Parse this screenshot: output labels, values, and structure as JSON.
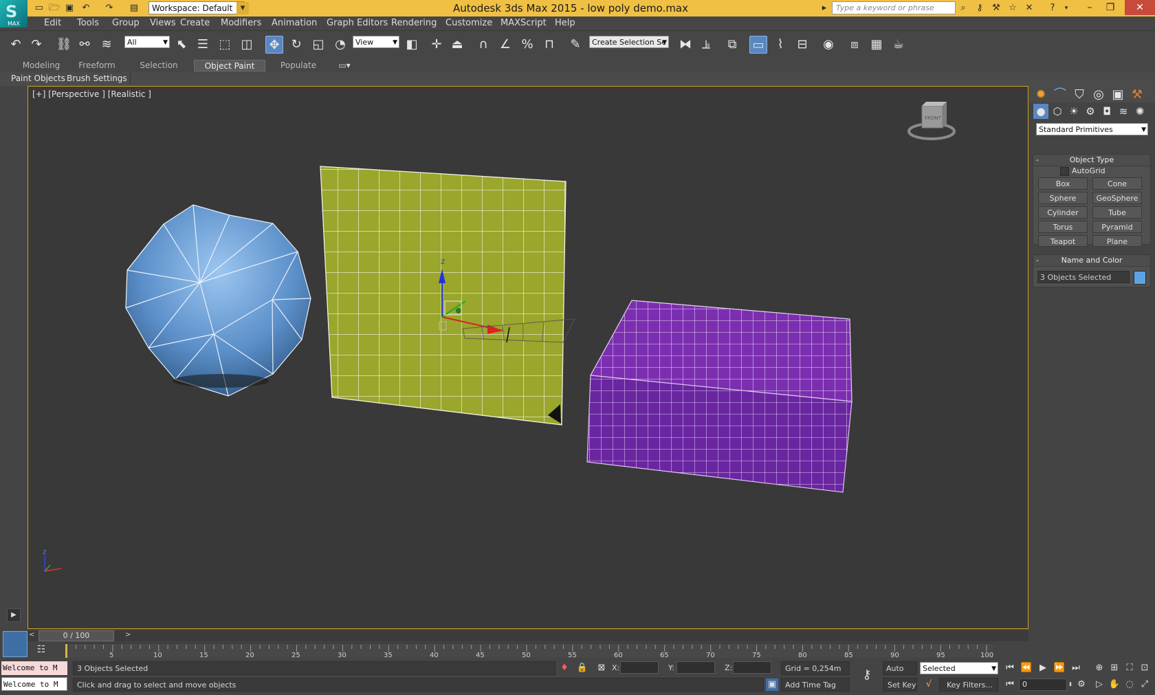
{
  "title_bar": {
    "logo_label": "MAX",
    "workspace": "Workspace: Default",
    "app_title": "Autodesk 3ds Max  2015  -  low poly demo.max",
    "search_placeholder": "Type a keyword or phrase"
  },
  "menu": [
    "Edit",
    "Tools",
    "Group",
    "Views",
    "Create",
    "Modifiers",
    "Animation",
    "Graph Editors",
    "Rendering",
    "Customize",
    "MAXScript",
    "Help"
  ],
  "toolbar": {
    "selection_filter": "All",
    "reference_coord": "View",
    "selection_set_placeholder": "Create Selection Se"
  },
  "ribbon": {
    "tabs": [
      "Modeling",
      "Freeform",
      "Selection",
      "Object Paint",
      "Populate"
    ],
    "active_tab": "Object Paint",
    "sub_buttons": [
      "Paint Objects",
      "Brush Settings"
    ]
  },
  "viewport": {
    "label": "[+] [Perspective ] [Realistic ]",
    "viewcube_face": "FRONT",
    "objects": [
      {
        "name": "geosphere",
        "color": "#5b8fc9"
      },
      {
        "name": "plane",
        "color": "#9aa62c"
      },
      {
        "name": "box",
        "color": "#7b2fb0"
      }
    ]
  },
  "command_panel": {
    "category": "Standard Primitives",
    "object_type_title": "Object Type",
    "autogrid_label": "AutoGrid",
    "buttons": [
      "Box",
      "Cone",
      "Sphere",
      "GeoSphere",
      "Cylinder",
      "Tube",
      "Torus",
      "Pyramid",
      "Teapot",
      "Plane"
    ],
    "name_color_title": "Name and Color",
    "name_value": "3 Objects Selected",
    "swatch_color": "#5ea2e3"
  },
  "timeline": {
    "frame_display": "0 / 100",
    "ticks": [
      "5",
      "10",
      "15",
      "20",
      "25",
      "30",
      "35",
      "40",
      "45",
      "50",
      "55",
      "60",
      "65",
      "70",
      "75",
      "80",
      "85",
      "90",
      "95",
      "100"
    ]
  },
  "status": {
    "maxscript_listener": "Welcome to M",
    "selection_info": "3 Objects Selected",
    "prompt": "Click and drag to select and move objects",
    "x_label": "X:",
    "y_label": "Y:",
    "z_label": "Z:",
    "grid": "Grid = 0,254m",
    "add_time_tag": "Add Time Tag",
    "auto_key": "Auto Key",
    "set_key": "Set Key",
    "key_mode": "Selected",
    "key_filters": "Key Filters...",
    "current_frame": "0"
  },
  "colors": {
    "title_bar": "#f0c044",
    "viewport_border": "#c9a227",
    "active_tool": "#5a87c0"
  }
}
